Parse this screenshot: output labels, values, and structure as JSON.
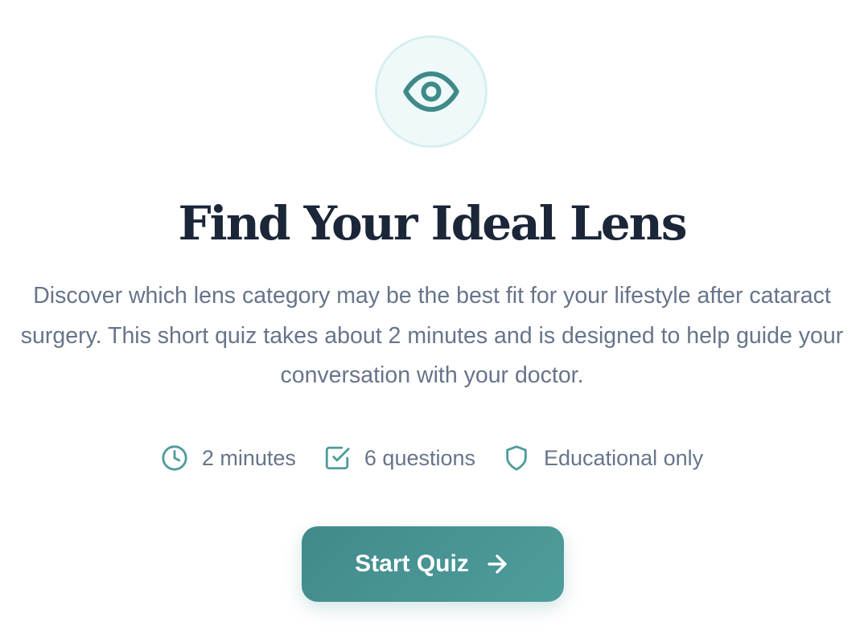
{
  "hero": {
    "icon": "eye-icon",
    "title": "Find Your Ideal Lens",
    "description": "Discover which lens category may be the best fit for your lifestyle after cataract surgery. This short quiz takes about 2 minutes and is designed to help guide your conversation with your doctor."
  },
  "features": [
    {
      "icon": "clock-icon",
      "label": "2 minutes"
    },
    {
      "icon": "checkbox-icon",
      "label": "6 questions"
    },
    {
      "icon": "shield-icon",
      "label": "Educational only"
    }
  ],
  "cta": {
    "label": "Start Quiz",
    "icon": "arrow-right-icon"
  },
  "colors": {
    "accent": "#428a8a",
    "title": "#1b2638",
    "text": "#67748a",
    "icon_bg": "#eff9f9"
  }
}
